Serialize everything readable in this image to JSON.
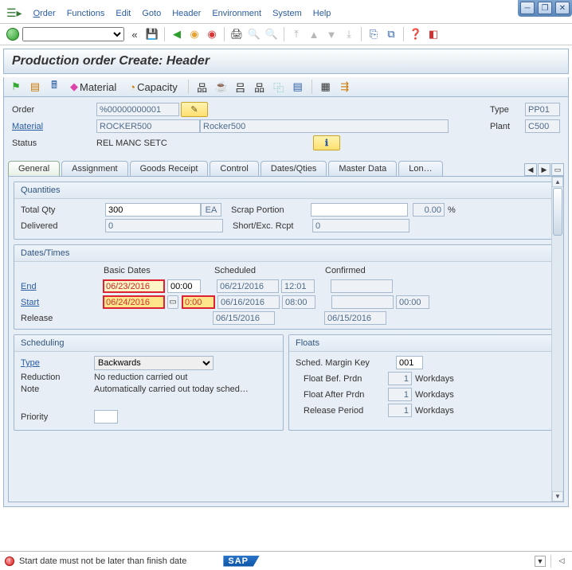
{
  "menu": {
    "order": "Order",
    "functions": "Functions",
    "edit": "Edit",
    "goto": "Goto",
    "header": "Header",
    "environment": "Environment",
    "system": "System",
    "help": "Help"
  },
  "title": "Production order Create: Header",
  "toolbar2": {
    "material": "Material",
    "capacity": "Capacity"
  },
  "header": {
    "order_lbl": "Order",
    "order_val": "%00000000001",
    "type_lbl": "Type",
    "type_val": "PP01",
    "material_lbl": "Material",
    "material_code": "ROCKER500",
    "material_desc": "Rocker500",
    "plant_lbl": "Plant",
    "plant_val": "C500",
    "status_lbl": "Status",
    "status_val": "REL  MANC SETC"
  },
  "tabs": [
    "General",
    "Assignment",
    "Goods Receipt",
    "Control",
    "Dates/Qties",
    "Master Data",
    "Lon…"
  ],
  "qty": {
    "title": "Quantities",
    "total_lbl": "Total Qty",
    "total_val": "300",
    "total_uom": "EA",
    "scrap_lbl": "Scrap Portion",
    "scrap_val": "",
    "scrap_pct": "0.00",
    "pct": "%",
    "deliv_lbl": "Delivered",
    "deliv_val": "0",
    "short_lbl": "Short/Exc. Rcpt",
    "short_val": "0"
  },
  "dates": {
    "title": "Dates/Times",
    "col_basic": "Basic Dates",
    "col_sched": "Scheduled",
    "col_conf": "Confirmed",
    "end_lbl": "End",
    "start_lbl": "Start",
    "release_lbl": "Release",
    "end_basic": "06/23/2016",
    "end_basic_t": "00:00",
    "end_sched": "06/21/2016",
    "end_sched_t": "12:01",
    "end_conf": "",
    "start_basic": "06/24/2016",
    "start_basic_t": "0:00",
    "start_sched": "06/16/2016",
    "start_sched_t": "08:00",
    "start_conf": "",
    "start_conf_t": "00:00",
    "rel_sched": "06/15/2016",
    "rel_conf": "06/15/2016"
  },
  "sched": {
    "title": "Scheduling",
    "type_lbl": "Type",
    "type_val": "Backwards",
    "reduction_lbl": "Reduction",
    "reduction_val": "No reduction carried out",
    "note_lbl": "Note",
    "note_val": "Automatically carried out today sched…",
    "priority_lbl": "Priority",
    "priority_val": ""
  },
  "floats": {
    "title": "Floats",
    "key_lbl": "Sched. Margin Key",
    "key_val": "001",
    "bef_lbl": "Float Bef. Prdn",
    "bef_val": "1",
    "unit": "Workdays",
    "aft_lbl": "Float After Prdn",
    "aft_val": "1",
    "rel_lbl": "Release Period",
    "rel_val": "1"
  },
  "status_msg": "Start date must not be later than finish date"
}
